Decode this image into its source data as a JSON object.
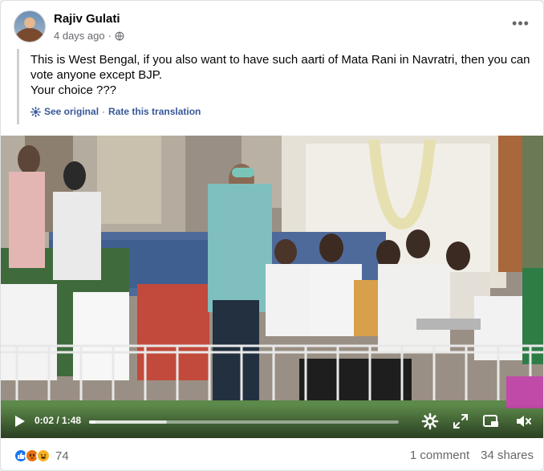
{
  "post": {
    "author": "Rajiv Gulati",
    "time": "4 days ago",
    "audience_icon": "globe-icon",
    "more_icon": "ellipsis-icon",
    "text": "This is West Bengal, if you also want to have such aarti of Mata Rani in Navratri, then you can vote anyone except BJP.\nYour choice ???",
    "see_original": "See original",
    "separator": "·",
    "rate_translation": "Rate this translation"
  },
  "video": {
    "current_time": "0:02",
    "duration": "1:48",
    "progress": 0.02,
    "buffered": 0.25,
    "controls": {
      "play_icon": "play-icon",
      "settings_icon": "gear-icon",
      "fullscreen_icon": "expand-icon",
      "pip_icon": "picture-in-picture-icon",
      "volume_icon": "volume-muted-icon"
    }
  },
  "footer": {
    "reactions": [
      "like",
      "angry",
      "haha"
    ],
    "reaction_count": "74",
    "comments": "1 comment",
    "shares": "34 shares"
  },
  "colors": {
    "link": "#385898",
    "like": "#1877f2",
    "angry": "#e9710f",
    "haha": "#f7b125"
  }
}
